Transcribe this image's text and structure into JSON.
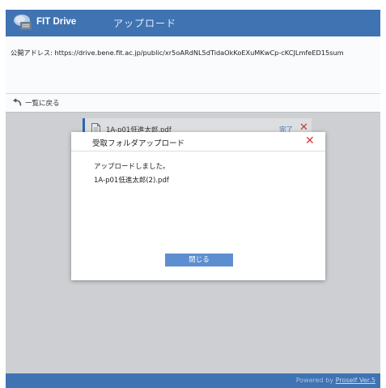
{
  "header": {
    "brand": "FIT Drive",
    "page_title": "アップロード",
    "logo_icon": "drive-logo-icon"
  },
  "address": {
    "text": "公開アドレス: https://drive.bene.fit.ac.jp/public/xr5oARdNL5dTidaOkKoEXuMKwCp-cKCJLmfeED15sum"
  },
  "back": {
    "label": "一覧に戻る",
    "icon": "back-arrow-icon"
  },
  "file_row": {
    "name": "1A-p01低進太郎.pdf",
    "status": "完了",
    "remove": "✕",
    "status_color": "#3a78c4"
  },
  "dialog": {
    "title": "受取フォルダアップロード",
    "close": "✕",
    "message": "アップロードしました。",
    "file": "1A-p01低進太郎(2).pdf",
    "button": "閉じる"
  },
  "footer": {
    "powered_prefix": "Powered by ",
    "powered_link": "Proself Ver.5"
  },
  "colors": {
    "accent": "#3f73b2",
    "button": "#5d8fd0",
    "danger": "#d73833"
  }
}
